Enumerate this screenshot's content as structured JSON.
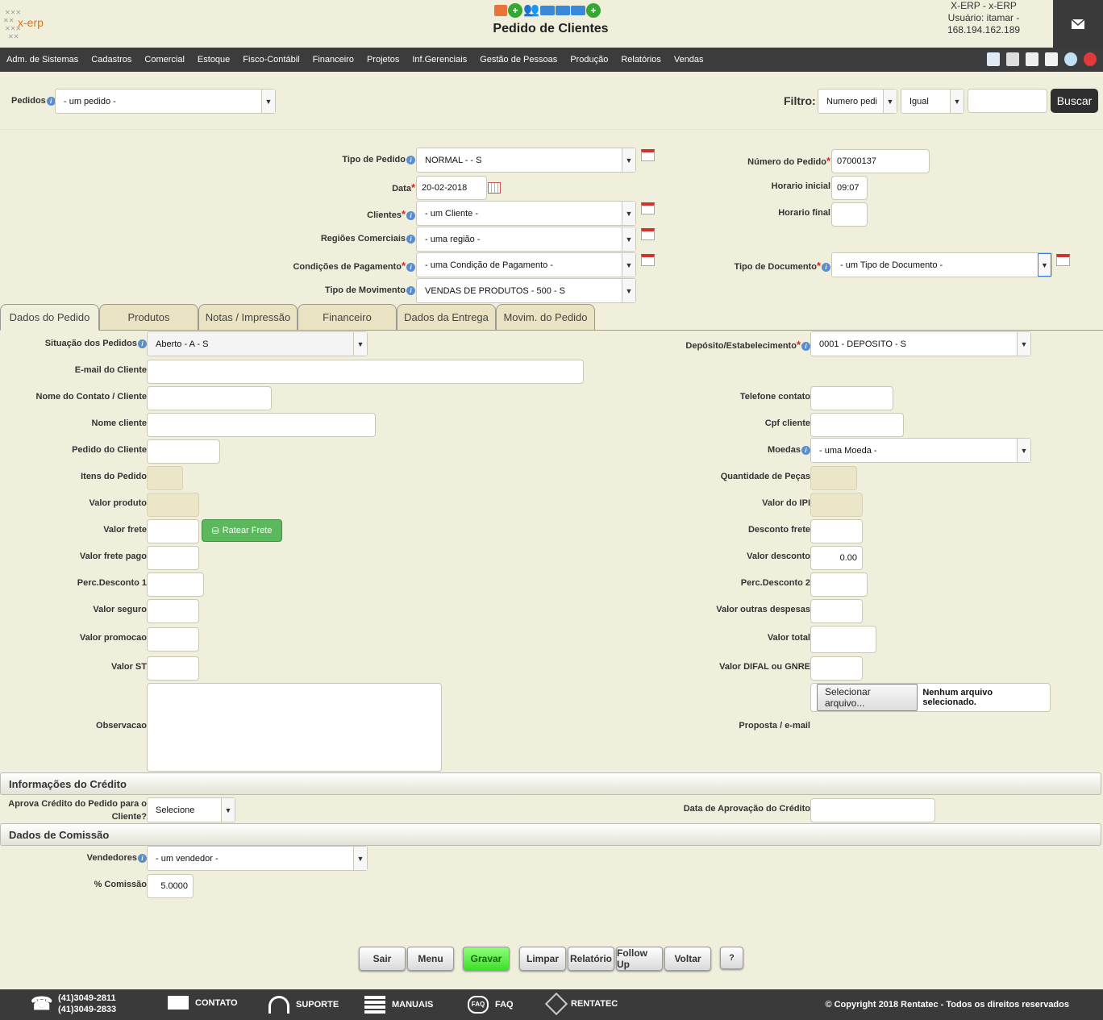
{
  "header": {
    "title": "Pedido de Clientes",
    "logo_text": "x-erp",
    "company": "X-ERP - x-ERP",
    "user": "Usuário: itamar -",
    "ip": "168.194.162.189"
  },
  "nav": {
    "items": [
      "Adm. de Sistemas",
      "Cadastros",
      "Comercial",
      "Estoque",
      "Fisco-Contábil",
      "Financeiro",
      "Projetos",
      "Inf.Gerenciais",
      "Gestão de Pessoas",
      "Produção",
      "Relatórios",
      "Vendas"
    ]
  },
  "filter": {
    "pedidos_label": "Pedidos",
    "pedidos_value": "- um pedido -",
    "filtro_label": "Filtro:",
    "field": "Numero pedi",
    "op": "Igual",
    "value": "",
    "search": "Buscar"
  },
  "form": {
    "tipo_pedido_label": "Tipo de Pedido",
    "tipo_pedido": "NORMAL - - S",
    "data_label": "Data",
    "data": "20-02-2018",
    "clientes_label": "Clientes",
    "clientes": "- um Cliente -",
    "regioes_label": "Regiões Comerciais",
    "regioes": "- uma região -",
    "cond_label": "Condições de Pagamento",
    "cond": "- uma Condição de Pagamento -",
    "movimento_label": "Tipo de Movimento",
    "movimento": "VENDAS DE PRODUTOS - 500 - S",
    "numero_label": "Número do Pedido",
    "numero": "07000137",
    "hora_ini_label": "Horario inicial",
    "hora_ini": "09:07",
    "hora_fim_label": "Horario final",
    "hora_fim": "",
    "tipo_doc_label": "Tipo de Documento",
    "tipo_doc": "- um Tipo de Documento -"
  },
  "tabs": [
    "Dados do Pedido",
    "Produtos",
    "Notas / Impressão",
    "Financeiro",
    "Dados da Entrega",
    "Movim. do Pedido"
  ],
  "dados": {
    "situacao_label": "Situação dos Pedidos",
    "situacao": "Aberto - A - S",
    "deposito_label": "Depósito/Estabelecimento",
    "deposito": "0001 - DEPOSITO - S",
    "email_label": "E-mail do Cliente",
    "contato_label": "Nome do Contato / Cliente",
    "telefone_label": "Telefone contato",
    "nome_label": "Nome cliente",
    "cpf_label": "Cpf cliente",
    "pedido_cli_label": "Pedido do Cliente",
    "moedas_label": "Moedas",
    "moedas": "- uma Moeda -",
    "itens_label": "Itens do Pedido",
    "qtd_pecas_label": "Quantidade de Peças",
    "valor_produto_label": "Valor produto",
    "valor_ipi_label": "Valor do IPI",
    "valor_frete_label": "Valor frete",
    "ratear": "Ratear Frete",
    "desc_frete_label": "Desconto frete",
    "frete_pago_label": "Valor frete pago",
    "valor_desconto_label": "Valor desconto",
    "valor_desconto": "0.00",
    "perc1_label": "Perc.Desconto 1",
    "perc2_label": "Perc.Desconto 2",
    "seguro_label": "Valor seguro",
    "outras_label": "Valor outras despesas",
    "promocao_label": "Valor promocao",
    "total_label": "Valor total",
    "st_label": "Valor ST",
    "difal_label": "Valor DIFAL ou GNRE",
    "obs_label": "Observacao",
    "file_btn": "Selecionar arquivo...",
    "file_status": "Nenhum arquivo selecionado.",
    "proposta_label": "Proposta / e-mail"
  },
  "credito": {
    "title": "Informações do Crédito",
    "aprova_label_1": "Aprova Crédito do Pedido para o",
    "aprova_label_2": "Cliente?",
    "aprova": "Selecione",
    "data_aprov_label": "Data de Aprovação do Crédito"
  },
  "comissao": {
    "title": "Dados de Comissão",
    "vendedores_label": "Vendedores",
    "vendedores": "- um vendedor -",
    "perc_label": "% Comissão",
    "perc": "5.0000"
  },
  "buttons": {
    "sair": "Sair",
    "menu": "Menu",
    "gravar": "Gravar",
    "limpar": "Limpar",
    "relatorio": "Relatório",
    "follow": "Follow Up",
    "voltar": "Voltar",
    "help": "?"
  },
  "footer": {
    "phone1": "(41)3049-2811",
    "phone2": "(41)3049-2833",
    "contato": "CONTATO",
    "suporte": "SUPORTE",
    "manuais": "MANUAIS",
    "faq": "FAQ",
    "rentatec": "RENTATEC",
    "copyright": "© Copyright 2018 Rentatec - Todos os direitos reservados"
  },
  "colors": {
    "nav": "#3c3c3c",
    "gravar": "#5df04a",
    "ratear": "#5cb85c",
    "background": "#f0efdc"
  }
}
